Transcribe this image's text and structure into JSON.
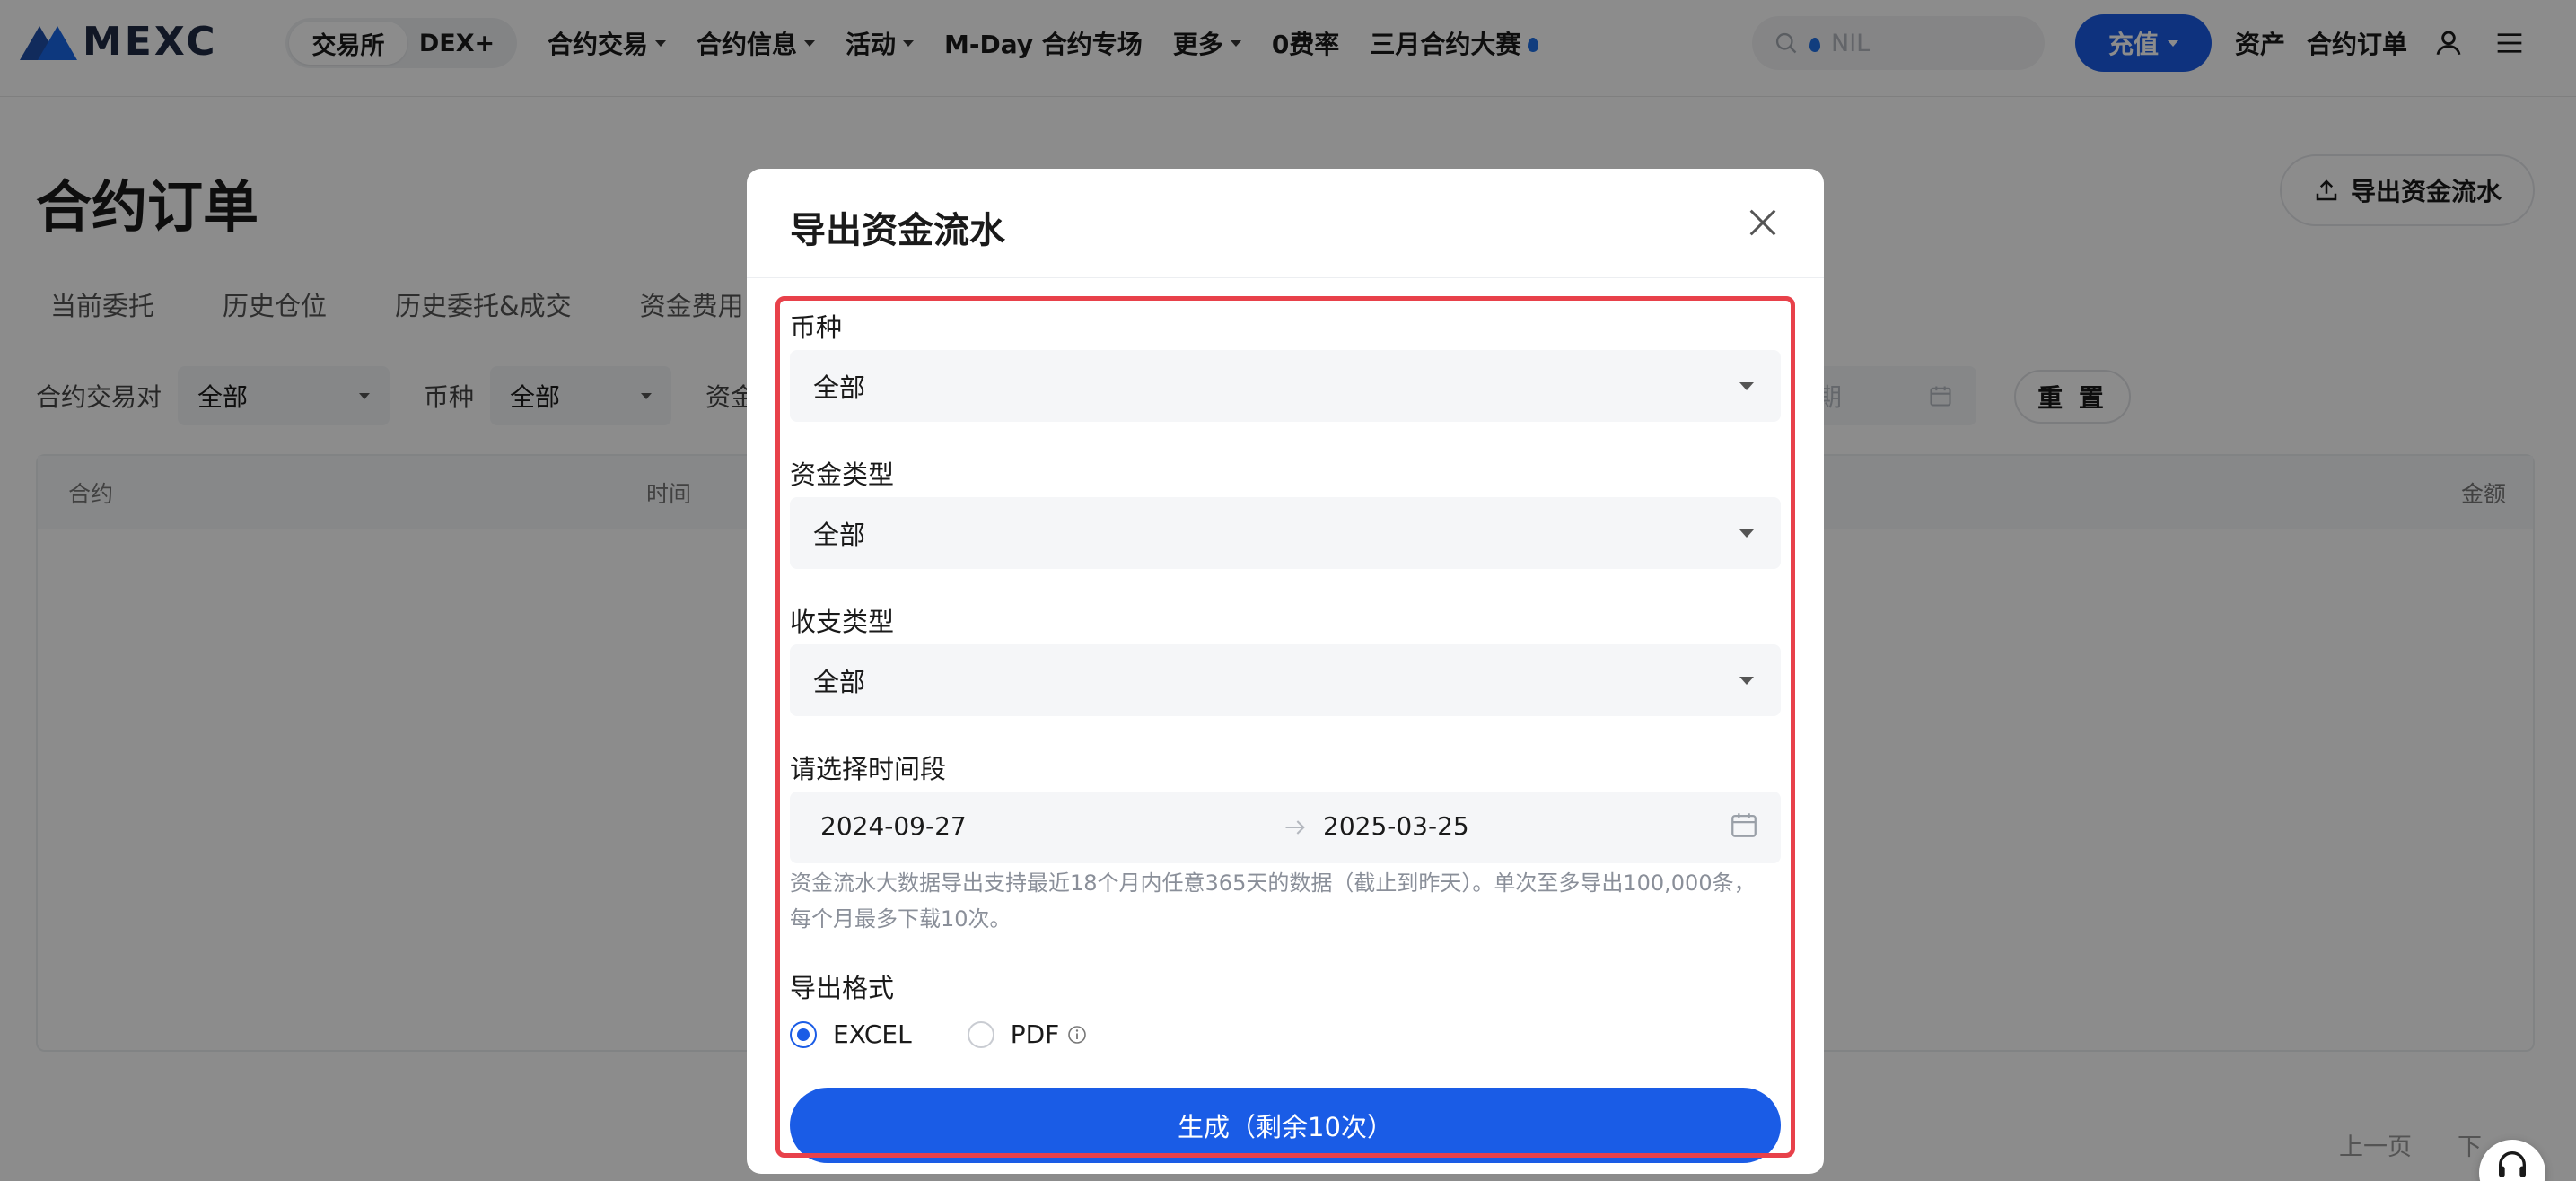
{
  "brand": {
    "name": "MEXC"
  },
  "header": {
    "segment": [
      "交易所",
      "DEX+"
    ],
    "nav": [
      {
        "label": "合约交易",
        "has_caret": true
      },
      {
        "label": "合约信息",
        "has_caret": true
      },
      {
        "label": "活动",
        "has_caret": true
      },
      {
        "label": "M-Day 合约专场",
        "has_caret": false
      },
      {
        "label": "更多",
        "has_caret": true
      },
      {
        "label": "0费率",
        "has_caret": false
      },
      {
        "label": "三月合约大赛",
        "has_caret": false
      }
    ],
    "search_placeholder": "NIL",
    "deposit_label": "充值",
    "assets_label": "资产",
    "orders_label": "合约订单"
  },
  "page": {
    "title": "合约订单",
    "export_label": "导出资金流水",
    "tabs": [
      "当前委托",
      "历史仓位",
      "历史委托&成交",
      "资金费用"
    ],
    "filters": {
      "pair_label": "合约交易对",
      "pair_value": "全部",
      "coin_label": "币种",
      "coin_value": "全部",
      "fund_label": "资金",
      "date_placeholder": "期",
      "reset_label": "重 置"
    },
    "table_headers": {
      "contract": "合约",
      "time": "时间",
      "amount": "金额"
    },
    "pager": {
      "prev": "上一页",
      "next": "下"
    }
  },
  "modal": {
    "title": "导出资金流水",
    "coin": {
      "label": "币种",
      "value": "全部"
    },
    "fund_type": {
      "label": "资金类型",
      "value": "全部"
    },
    "flow_type": {
      "label": "收支类型",
      "value": "全部"
    },
    "period": {
      "label": "请选择时间段",
      "start": "2024-09-27",
      "end": "2025-03-25"
    },
    "hint_line1": "资金流水大数据导出支持最近18个月内任意365天的数据（截止到昨天）。单次至多导出100,000条，",
    "hint_line2": "每个月最多下载10次。",
    "format": {
      "label": "导出格式",
      "options": [
        "EXCEL",
        "PDF"
      ],
      "selected": "EXCEL"
    },
    "generate_label": "生成（剩余10次）"
  },
  "colors": {
    "primary": "#1a5ce6",
    "highlight_border": "#e8414a",
    "overlay": "rgba(0,0,0,0.45)"
  }
}
